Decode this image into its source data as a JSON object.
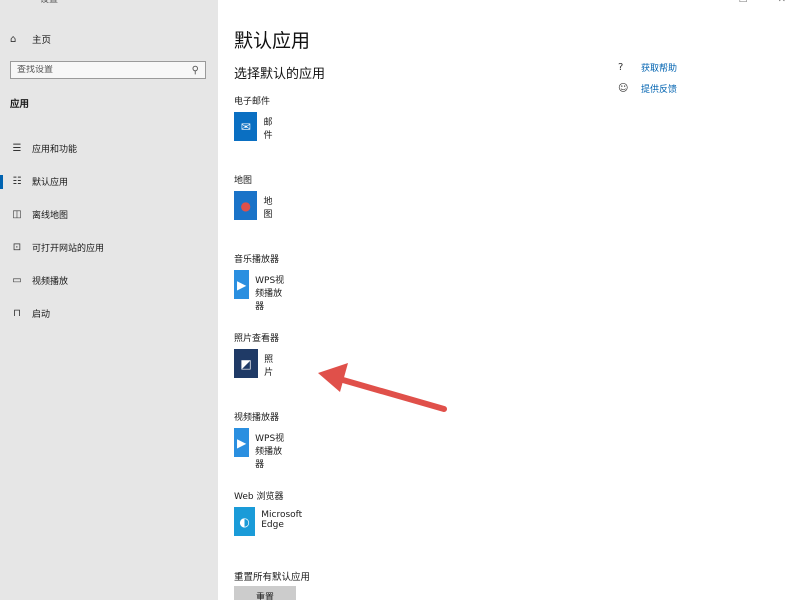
{
  "window": {
    "back_glyph": "←",
    "title": "设置",
    "controls": [
      "—",
      "☐",
      "✕"
    ]
  },
  "sidebar": {
    "home": {
      "label": "主页",
      "icon": "home-icon",
      "glyph": "⌂"
    },
    "search": {
      "placeholder": "查找设置",
      "icon": "search-icon",
      "glyph": "⚲"
    },
    "section": "应用",
    "items": [
      {
        "label": "应用和功能",
        "icon": "list-icon",
        "glyph": "☰",
        "selected": false
      },
      {
        "label": "默认应用",
        "icon": "default-apps-icon",
        "glyph": "☷",
        "selected": true
      },
      {
        "label": "离线地图",
        "icon": "map-icon",
        "glyph": "◫",
        "selected": false
      },
      {
        "label": "可打开网站的应用",
        "icon": "web-app-icon",
        "glyph": "⊡",
        "selected": false
      },
      {
        "label": "视频播放",
        "icon": "video-icon",
        "glyph": "▭",
        "selected": false
      },
      {
        "label": "启动",
        "icon": "startup-icon",
        "glyph": "⊓",
        "selected": false
      }
    ]
  },
  "main": {
    "title": "默认应用",
    "subtitle": "选择默认的应用",
    "help": [
      {
        "label": "获取帮助",
        "icon": "help-icon",
        "glyph": "?"
      },
      {
        "label": "提供反馈",
        "icon": "feedback-icon",
        "glyph": "☺"
      }
    ],
    "defaults": [
      {
        "category": "电子邮件",
        "app": "邮件",
        "icon": "mail-icon",
        "glyph": "✉",
        "color": "#0a6fc2"
      },
      {
        "category": "地图",
        "app": "地图",
        "icon": "maps-icon",
        "glyph": "●",
        "color": "#1a73c8"
      },
      {
        "category": "音乐播放器",
        "app": "WPS视频播放器",
        "icon": "wps-player-icon",
        "glyph": "▶",
        "color": "#2a8fe0"
      },
      {
        "category": "照片查看器",
        "app": "照片",
        "icon": "photos-icon",
        "glyph": "◩",
        "color": "#1f3a66"
      },
      {
        "category": "视频播放器",
        "app": "WPS视频播放器",
        "icon": "wps-player-icon",
        "glyph": "▶",
        "color": "#2a8fe0"
      },
      {
        "category": "Web 浏览器",
        "app": "Microsoft Edge",
        "icon": "edge-icon",
        "glyph": "◐",
        "color": "#1a9bd8"
      }
    ],
    "reset_label": "重置所有默认应用",
    "reset_button": "重置"
  },
  "colors": {
    "accent": "#0063b1",
    "sidebar_bg": "#e6e6e6",
    "arrow": "#e0504a"
  }
}
